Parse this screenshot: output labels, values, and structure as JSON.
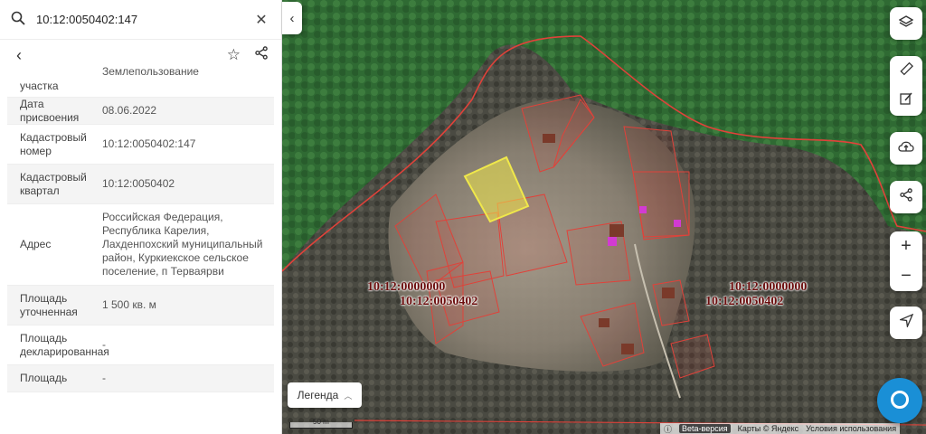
{
  "search": {
    "value": "10:12:0050402:147"
  },
  "props": [
    {
      "k": "участка",
      "v": "Землепользование"
    },
    {
      "k": "Дата присвоения",
      "v": "08.06.2022"
    },
    {
      "k": "Кадастровый номер",
      "v": "10:12:0050402:147"
    },
    {
      "k": "Кадастровый квартал",
      "v": "10:12:0050402"
    },
    {
      "k": "Адрес",
      "v": "Российская Федерация, Республика Карелия, Лахденпохский муниципальный район, Куркиекское сельское поселение, п Терваярви"
    },
    {
      "k": "Площадь уточненная",
      "v": "1 500 кв. м"
    },
    {
      "k": "Площадь декларированная",
      "v": "-"
    },
    {
      "k": "Площадь",
      "v": "-"
    }
  ],
  "map": {
    "labels": [
      {
        "line1": "10:12:0000000",
        "line2": "10:12:0050402"
      },
      {
        "line1": "10:12:0000000",
        "line2": "10:12:0050402"
      }
    ],
    "legend": "Легенда",
    "scale": "50 m",
    "beta": "Beta-версия",
    "copyright": "Карты © Яндекс",
    "terms": "Условия использования"
  },
  "colors": {
    "boundary": "#e0423a",
    "selected": "#f0e84a",
    "marker": "#d23bd2"
  },
  "icons": [
    "search-icon",
    "close-icon",
    "back-icon",
    "star-icon",
    "share-icon",
    "collapse-icon",
    "layers-icon",
    "ruler-icon",
    "edit-icon",
    "upload-icon",
    "share-map-icon",
    "zoom-in-icon",
    "zoom-out-icon",
    "locate-icon",
    "chat-icon",
    "chevron-up-icon"
  ]
}
